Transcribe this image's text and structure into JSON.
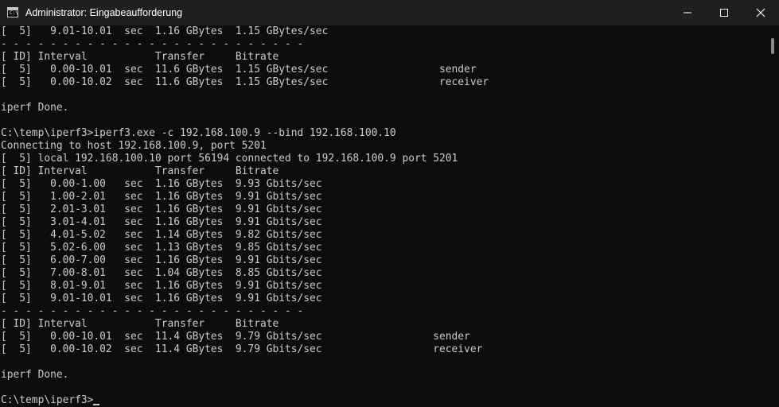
{
  "window": {
    "title": "Administrator: Eingabeaufforderung",
    "icon": "command-prompt-icon",
    "icon_prompt_glyph": "C:\\",
    "controls": [
      "minimize-icon",
      "maximize-icon",
      "close-icon"
    ]
  },
  "colors": {
    "background": "#0c0c0c",
    "titlebar": "#1f1f1f",
    "text": "#cccccc"
  },
  "console": {
    "lines": [
      "[  5]   9.01-10.01  sec  1.16 GBytes  1.15 GBytes/sec",
      "- - - - - - - - - - - - - - - - - - - - - - - - -",
      "[ ID] Interval           Transfer     Bitrate",
      "[  5]   0.00-10.01  sec  11.6 GBytes  1.15 GBytes/sec                  sender",
      "[  5]   0.00-10.02  sec  11.6 GBytes  1.15 GBytes/sec                  receiver",
      "",
      "iperf Done.",
      "",
      "C:\\temp\\iperf3>iperf3.exe -c 192.168.100.9 --bind 192.168.100.10",
      "Connecting to host 192.168.100.9, port 5201",
      "[  5] local 192.168.100.10 port 56194 connected to 192.168.100.9 port 5201",
      "[ ID] Interval           Transfer     Bitrate",
      "[  5]   0.00-1.00   sec  1.16 GBytes  9.93 Gbits/sec",
      "[  5]   1.00-2.01   sec  1.16 GBytes  9.91 Gbits/sec",
      "[  5]   2.01-3.01   sec  1.16 GBytes  9.91 Gbits/sec",
      "[  5]   3.01-4.01   sec  1.16 GBytes  9.91 Gbits/sec",
      "[  5]   4.01-5.02   sec  1.14 GBytes  9.82 Gbits/sec",
      "[  5]   5.02-6.00   sec  1.13 GBytes  9.85 Gbits/sec",
      "[  5]   6.00-7.00   sec  1.16 GBytes  9.91 Gbits/sec",
      "[  5]   7.00-8.01   sec  1.04 GBytes  8.85 Gbits/sec",
      "[  5]   8.01-9.01   sec  1.16 GBytes  9.91 Gbits/sec",
      "[  5]   9.01-10.01  sec  1.16 GBytes  9.91 Gbits/sec",
      "- - - - - - - - - - - - - - - - - - - - - - - - -",
      "[ ID] Interval           Transfer     Bitrate",
      "[  5]   0.00-10.01  sec  11.4 GBytes  9.79 Gbits/sec                  sender",
      "[  5]   0.00-10.02  sec  11.4 GBytes  9.79 Gbits/sec                  receiver",
      "",
      "iperf Done.",
      "",
      "C:\\temp\\iperf3>"
    ]
  }
}
